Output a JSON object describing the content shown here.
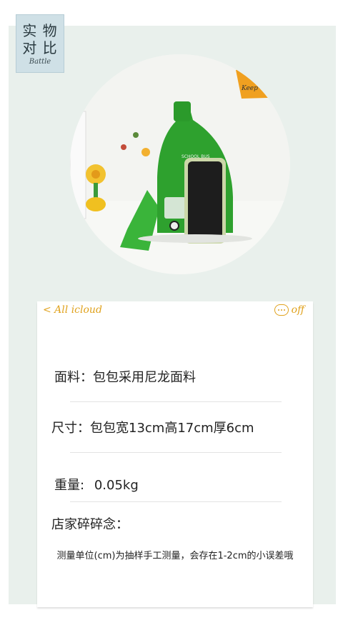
{
  "badge": {
    "line1": "实 物",
    "line2": "对 比",
    "sub": "Battle"
  },
  "photo": {
    "sign_text": "Keep",
    "bag_label": "SCHOOL BUS",
    "colors": {
      "bag": "#2ea12e",
      "strap": "#3ab43a",
      "sign": "#f0a020",
      "phone": "#1d1d1d"
    }
  },
  "card": {
    "back_label": "< All icloud",
    "off_label": "off",
    "fabric_label": "面料：包包采用尼龙面料",
    "size_label": "尺寸：包包宽13cm高17cm厚6cm",
    "weight_label": "重量:",
    "weight_value": "0.05kg",
    "store_note_title": "店家碎碎念：",
    "store_note_text": "测量单位(cm)为抽样手工测量，会存在1-2cm的小误差哦",
    "accent_color": "#e0a21d"
  }
}
